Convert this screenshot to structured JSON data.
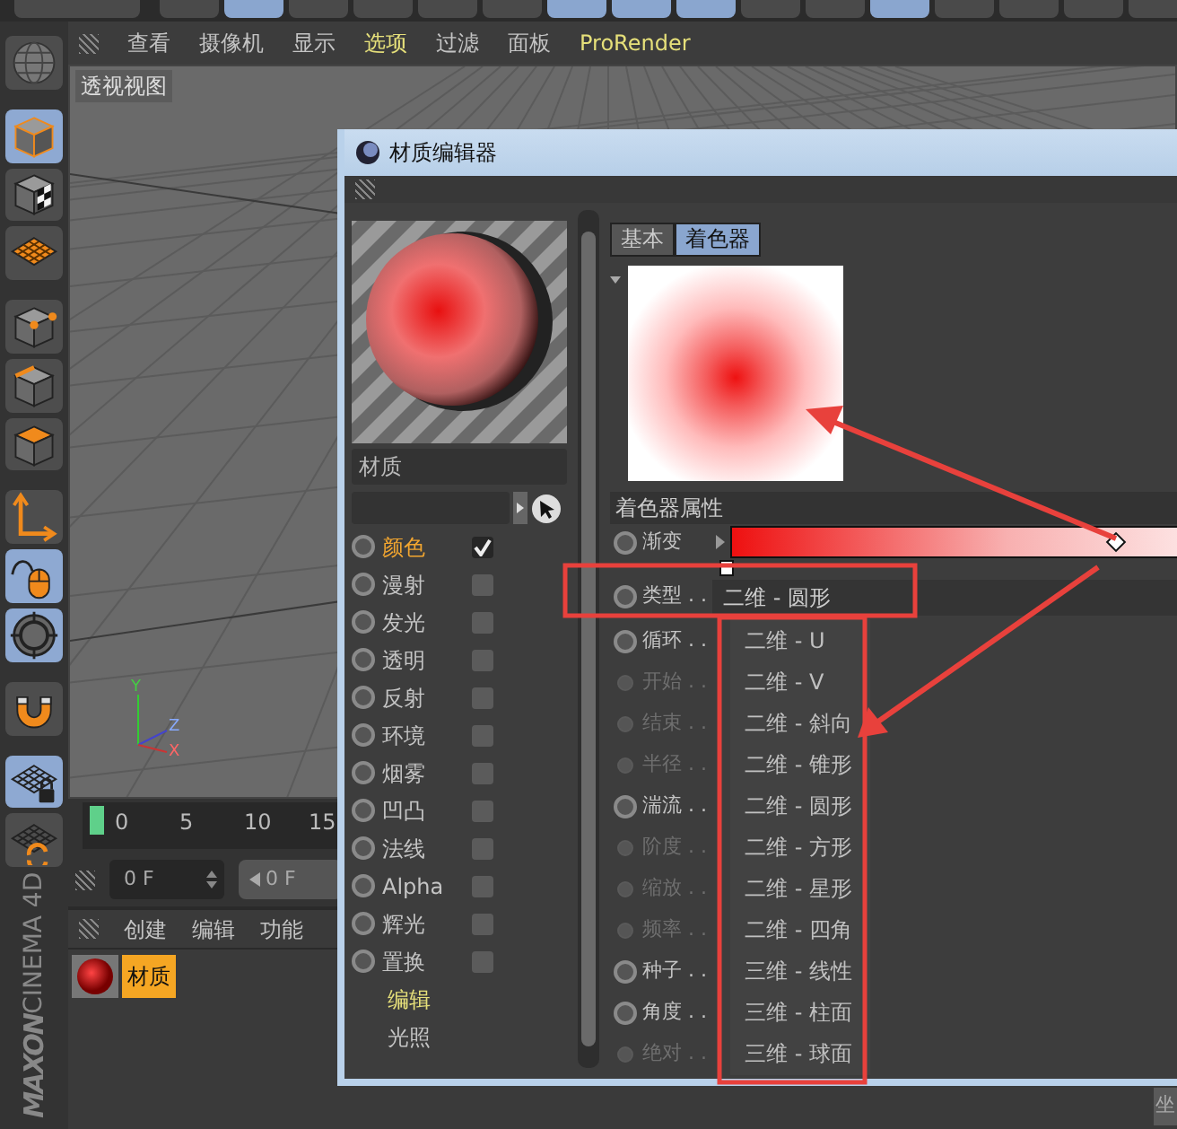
{
  "top_toolbar": [
    {
      "selected": false
    },
    {
      "selected": false
    },
    {
      "selected": true
    },
    {
      "selected": false
    },
    {
      "selected": false
    },
    {
      "selected": false
    },
    {
      "selected": false
    },
    {
      "selected": true
    },
    {
      "selected": true
    },
    {
      "selected": true
    },
    {
      "selected": false
    },
    {
      "selected": false
    },
    {
      "selected": true
    },
    {
      "selected": false
    },
    {
      "selected": false
    },
    {
      "selected": false
    },
    {
      "selected": false
    }
  ],
  "left_tools": [
    {
      "kind": "globe",
      "selected": false
    },
    {
      "kind": "cube",
      "selected": true
    },
    {
      "kind": "texture",
      "selected": false
    },
    {
      "kind": "plane",
      "selected": false
    },
    {
      "kind": "points",
      "selected": false
    },
    {
      "kind": "edges",
      "selected": false
    },
    {
      "kind": "faces",
      "selected": false
    },
    {
      "kind": "axis",
      "selected": false
    },
    {
      "kind": "mouse",
      "selected": true
    },
    {
      "kind": "snap",
      "selected": true
    },
    {
      "kind": "magnet",
      "selected": false
    },
    {
      "kind": "lock-grid",
      "selected": true
    },
    {
      "kind": "refresh-grid",
      "selected": false
    }
  ],
  "logo": {
    "brand": "MAXON",
    "product": "CINEMA 4D"
  },
  "viewport_menu": [
    {
      "label": "查看",
      "highlighted": false
    },
    {
      "label": "摄像机",
      "highlighted": false
    },
    {
      "label": "显示",
      "highlighted": false
    },
    {
      "label": "选项",
      "highlighted": true
    },
    {
      "label": "过滤",
      "highlighted": false
    },
    {
      "label": "面板",
      "highlighted": false
    },
    {
      "label": "ProRender",
      "highlighted": true
    }
  ],
  "viewport": {
    "title": "透视视图",
    "axes": [
      "Y",
      "Z",
      "X"
    ]
  },
  "timeline": {
    "ticks": [
      "0",
      "5",
      "10",
      "15"
    ],
    "frame_field": "0 F",
    "start_field": "0 F"
  },
  "material_manager": {
    "menu": [
      "创建",
      "编辑",
      "功能"
    ],
    "materials": [
      {
        "name": "材质",
        "selected": true
      }
    ]
  },
  "material_editor": {
    "title": "材质编辑器",
    "name": "材质",
    "channels": [
      {
        "label": "颜色",
        "checked": true,
        "selected": true
      },
      {
        "label": "漫射",
        "checked": false,
        "selected": false
      },
      {
        "label": "发光",
        "checked": false,
        "selected": false
      },
      {
        "label": "透明",
        "checked": false,
        "selected": false
      },
      {
        "label": "反射",
        "checked": false,
        "selected": false
      },
      {
        "label": "环境",
        "checked": false,
        "selected": false
      },
      {
        "label": "烟雾",
        "checked": false,
        "selected": false
      },
      {
        "label": "凹凸",
        "checked": false,
        "selected": false
      },
      {
        "label": "法线",
        "checked": false,
        "selected": false
      },
      {
        "label": "Alpha",
        "checked": false,
        "selected": false
      },
      {
        "label": "辉光",
        "checked": false,
        "selected": false
      },
      {
        "label": "置换",
        "checked": false,
        "selected": false
      }
    ],
    "pages": [
      {
        "label": "编辑",
        "selected": true
      },
      {
        "label": "光照",
        "selected": false
      }
    ],
    "tabs": [
      {
        "label": "基本",
        "selected": false
      },
      {
        "label": "着色器",
        "selected": true
      }
    ],
    "section": "着色器属性",
    "properties": [
      {
        "kind": "gradient",
        "label": "渐变",
        "disabled": false
      },
      {
        "kind": "dropdown",
        "label": "类型 . .",
        "value": "二维 - 圆形",
        "disabled": false
      },
      {
        "kind": "plain",
        "label": "循环 . .",
        "disabled": false
      },
      {
        "kind": "plain",
        "label": "开始 . .",
        "disabled": true
      },
      {
        "kind": "plain",
        "label": "结束 . .",
        "disabled": true
      },
      {
        "kind": "plain",
        "label": "半径 . .",
        "disabled": true
      },
      {
        "kind": "plain",
        "label": "湍流 . .",
        "disabled": false
      },
      {
        "kind": "plain",
        "label": "阶度 . .",
        "disabled": true
      },
      {
        "kind": "plain",
        "label": "缩放 . .",
        "disabled": true
      },
      {
        "kind": "plain",
        "label": "频率 . .",
        "disabled": true
      },
      {
        "kind": "plain",
        "label": "种子 . .",
        "disabled": false
      },
      {
        "kind": "plain",
        "label": "角度 . .",
        "disabled": false
      },
      {
        "kind": "plain",
        "label": "绝对 . .",
        "disabled": true
      }
    ],
    "dropdown_options": [
      "二维 - U",
      "二维 - V",
      "二维 - 斜向",
      "二维 - 锥形",
      "二维 - 圆形",
      "二维 - 方形",
      "二维 - 星形",
      "二维 - 四角",
      "三维 - 线性",
      "三维 - 柱面",
      "三维 - 球面"
    ]
  },
  "corner_tab": "坐"
}
